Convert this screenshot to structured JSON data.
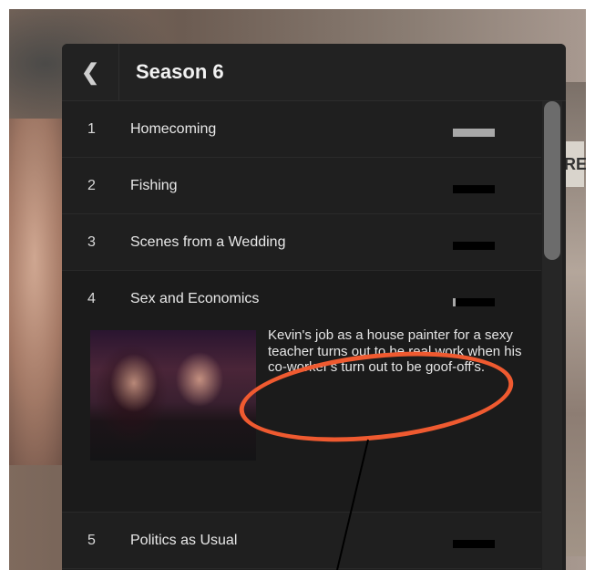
{
  "header": {
    "back_label": "❮",
    "title": "Season 6"
  },
  "episodes": [
    {
      "number": "1",
      "title": "Homecoming",
      "progress": 1.0
    },
    {
      "number": "2",
      "title": "Fishing",
      "progress": 0.0
    },
    {
      "number": "3",
      "title": "Scenes from a Wedding",
      "progress": 0.0
    },
    {
      "number": "4",
      "title": "Sex and Economics",
      "progress": 0.06,
      "description": "Kevin's job as a house painter for a sexy teacher turns out to be real work when his co-worker's turn out to be goof-off's."
    },
    {
      "number": "5",
      "title": "Politics as Usual",
      "progress": 0.0
    }
  ],
  "colors": {
    "annotation": "#ef5a30",
    "progress_fill": "#a8a8a8"
  },
  "icons": {
    "back": "chevron-left-icon"
  }
}
